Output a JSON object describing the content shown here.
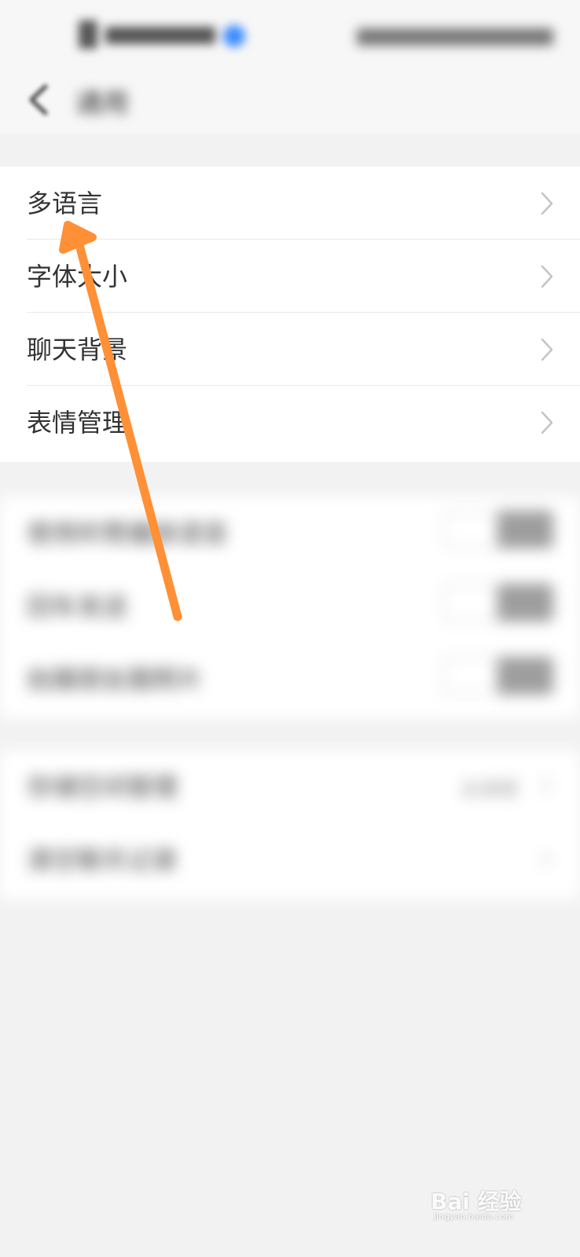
{
  "header": {
    "title": "通用"
  },
  "settings_group_1": {
    "items": [
      {
        "label": "多语言"
      },
      {
        "label": "字体大小"
      },
      {
        "label": "聊天背景"
      },
      {
        "label": "表情管理"
      }
    ]
  },
  "settings_group_2": {
    "items": [
      {
        "label": "使用听筒播放语音"
      },
      {
        "label": "回车发送"
      },
      {
        "label": "拍摄朋友圈照片"
      }
    ]
  },
  "settings_group_3": {
    "items": [
      {
        "label": "存储空间管理",
        "value": "去清理"
      },
      {
        "label": "清空聊天记录"
      }
    ]
  },
  "watermark": {
    "brand": "Bai 经验",
    "url": "jingyan.baidu.com"
  },
  "colors": {
    "annotation_arrow": "#ff9036",
    "background": "#f2f2f2",
    "card": "#ffffff"
  }
}
